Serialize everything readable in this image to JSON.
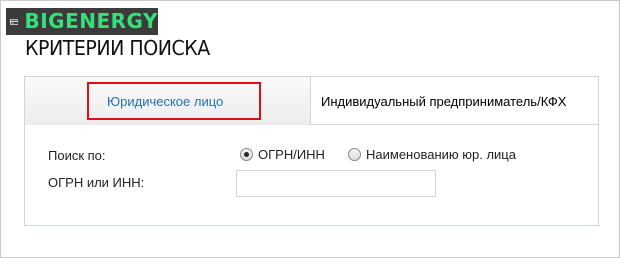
{
  "logo": {
    "text": "BIGENERGY",
    "icon": "card-icon",
    "brand_color": "#34e07a",
    "bg_color": "#3b3b3b"
  },
  "page": {
    "title": "КРИТЕРИИ ПОИСКА"
  },
  "tabs": [
    {
      "label": "Юридическое лицо",
      "active": true
    },
    {
      "label": "Индивидуальный предприниматель/КФХ",
      "active": false
    }
  ],
  "form": {
    "search_by_label": "Поиск по:",
    "options": [
      {
        "label": "ОГРН/ИНН",
        "checked": true
      },
      {
        "label": "Наименованию юр. лица",
        "checked": false
      }
    ],
    "ogrn_inn_label": "ОГРН или ИНН:",
    "ogrn_inn_value": "",
    "ogrn_inn_placeholder": ""
  },
  "colors": {
    "active_tab_text": "#2a6fb0",
    "highlight": "#e01010"
  }
}
